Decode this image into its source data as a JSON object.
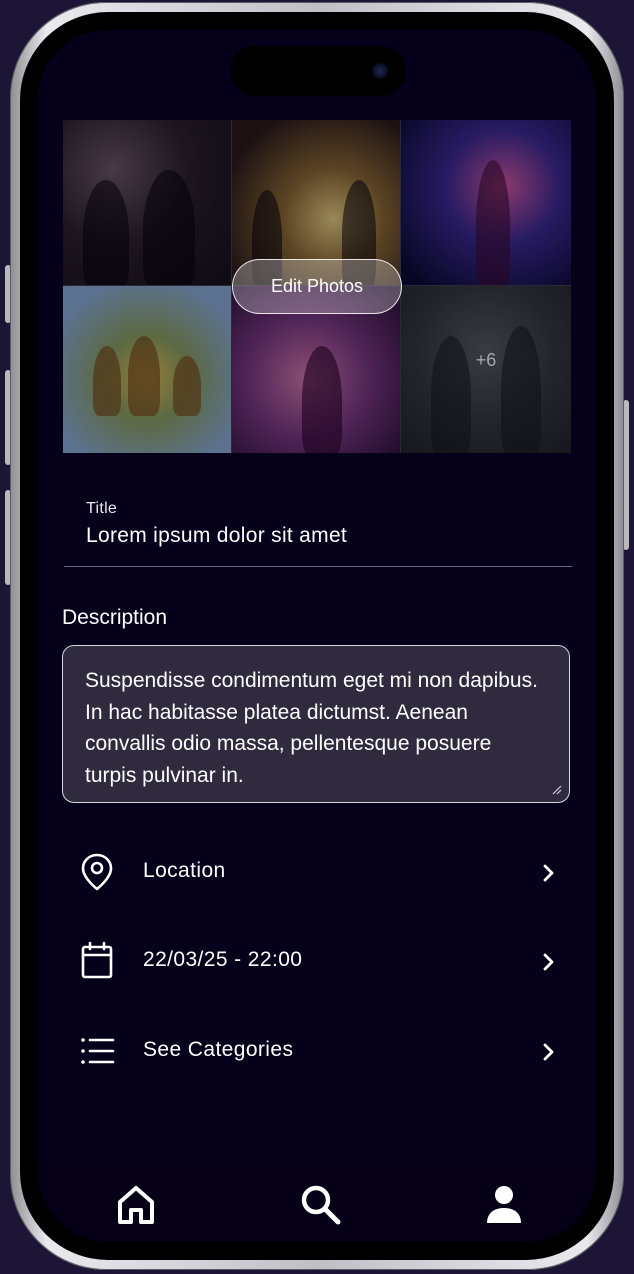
{
  "photos": {
    "edit_button_label": "Edit Photos",
    "more_count": "+6",
    "items": [
      {
        "icon": "party-photo-1"
      },
      {
        "icon": "party-photo-2"
      },
      {
        "icon": "party-photo-3"
      },
      {
        "icon": "party-photo-4"
      },
      {
        "icon": "party-photo-5"
      },
      {
        "icon": "party-photo-6"
      }
    ]
  },
  "form": {
    "title_label": "Title",
    "title_value": "Lorem ipsum dolor sit amet",
    "description_label": "Description",
    "description_value": "Suspendisse condimentum eget mi non dapibus. In hac habitasse platea dictumst. Aenean convallis odio massa, pellentesque posuere turpis pulvinar in."
  },
  "rows": [
    {
      "label": "Location",
      "icon": "location-pin-icon"
    },
    {
      "label": "22/03/25 - 22:00",
      "icon": "calendar-icon"
    },
    {
      "label": "See Categories",
      "icon": "list-icon"
    }
  ],
  "bottom_nav": [
    {
      "icon": "home-icon"
    },
    {
      "icon": "search-icon"
    },
    {
      "icon": "profile-icon"
    }
  ],
  "colors": {
    "screen_background": "#07001a",
    "page_background": "#1d1535",
    "field_background": "#302a3e",
    "text": "#ffffff"
  }
}
